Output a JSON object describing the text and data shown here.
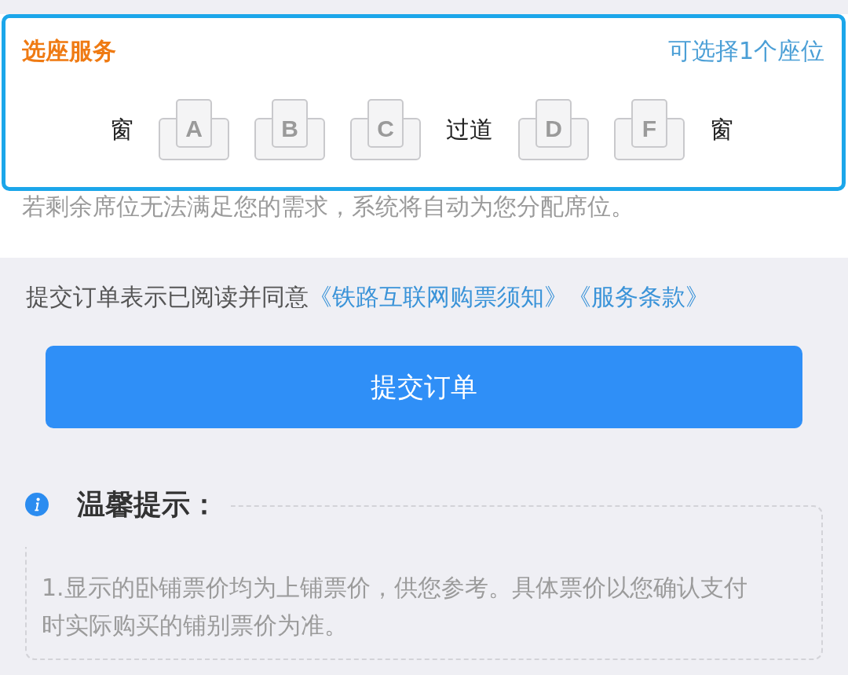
{
  "panel": {
    "title": "选座服务",
    "hint": "可选择1个座位",
    "seat_row": [
      {
        "kind": "label",
        "text": "窗"
      },
      {
        "kind": "seat",
        "label": "A",
        "selected": false
      },
      {
        "kind": "seat",
        "label": "B",
        "selected": false
      },
      {
        "kind": "seat",
        "label": "C",
        "selected": false
      },
      {
        "kind": "label",
        "text": "过道"
      },
      {
        "kind": "seat",
        "label": "D",
        "selected": false
      },
      {
        "kind": "seat",
        "label": "F",
        "selected": false
      },
      {
        "kind": "label",
        "text": "窗"
      }
    ]
  },
  "auto_assign_note": "若剩余席位无法满足您的需求，系统将自动为您分配席位。",
  "agreement": {
    "text": "提交订单表示已阅读并同意",
    "links": [
      "《铁路互联网购票须知》",
      "《服务条款》"
    ]
  },
  "submit_button": "提交订单",
  "tips": {
    "title": "温馨提示：",
    "items": [
      "1.显示的卧铺票价均为上铺票价，供您参考。具体票价以您确认支付时实际购买的铺别票价为准。"
    ]
  }
}
